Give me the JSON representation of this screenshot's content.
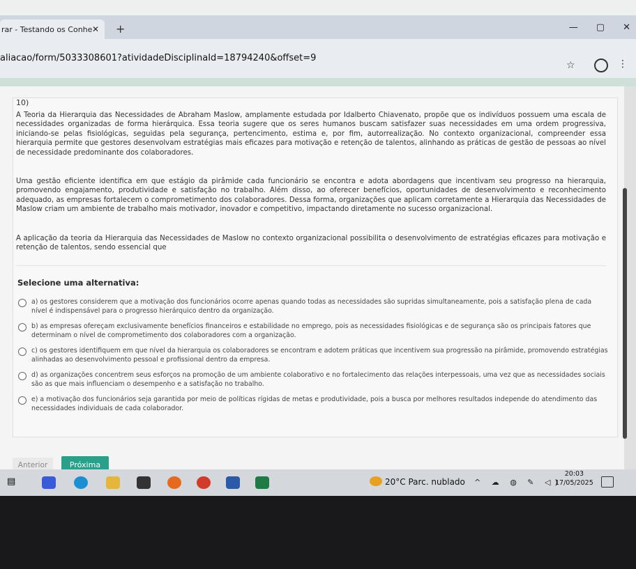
{
  "browser": {
    "tab_title": "rar - Testando os Conhe",
    "tab_close": "✕",
    "new_tab": "+",
    "url": "aliacao/form/5033308601?atividadeDisciplinaId=18794240&offset=9",
    "window_controls": {
      "minimize": "—",
      "maximize": "▢",
      "close": "✕"
    }
  },
  "question": {
    "number": "10)",
    "paragraphs": [
      "A Teoria da Hierarquia das Necessidades de Abraham Maslow, amplamente estudada por Idalberto Chiavenato, propõe que os indivíduos possuem uma escala de necessidades organizadas de forma hierárquica. Essa teoria sugere que os seres humanos buscam satisfazer suas necessidades em uma ordem progressiva, iniciando-se pelas fisiológicas, seguidas pela segurança, pertencimento, estima e, por fim, autorrealização. No contexto organizacional, compreender essa hierarquia permite que gestores desenvolvam estratégias mais eficazes para motivação e retenção de talentos, alinhando as práticas de gestão de pessoas ao nível de necessidade predominante dos colaboradores.",
      "Uma gestão eficiente identifica em que estágio da pirâmide cada funcionário se encontra e adota abordagens que incentivam seu progresso na hierarquia, promovendo engajamento, produtividade e satisfação no trabalho. Além disso, ao oferecer benefícios, oportunidades de desenvolvimento e reconhecimento adequado, as empresas fortalecem o comprometimento dos colaboradores. Dessa forma, organizações que aplicam corretamente a Hierarquia das Necessidades de Maslow criam um ambiente de trabalho mais motivador, inovador e competitivo, impactando diretamente no sucesso organizacional.",
      "A aplicação da teoria da Hierarquia das Necessidades de Maslow no contexto organizacional possibilita o desenvolvimento de estratégias eficazes para motivação e retenção de talentos, sendo essencial que"
    ],
    "select_label": "Selecione uma alternativa:",
    "alternatives": [
      "a) os gestores considerem que a motivação dos funcionários ocorre apenas quando todas as necessidades são supridas simultaneamente, pois a satisfação plena de cada nível é indispensável para o progresso hierárquico dentro da organização.",
      "b) as empresas ofereçam exclusivamente benefícios financeiros e estabilidade no emprego, pois as necessidades fisiológicas e de segurança são os principais fatores que determinam o nível de comprometimento dos colaboradores com a organização.",
      "c) os gestores identifiquem em que nível da hierarquia os colaboradores se encontram e adotem práticas que incentivem sua progressão na pirâmide, promovendo estratégias alinhadas ao desenvolvimento pessoal e profissional dentro da empresa.",
      "d) as organizações concentrem seus esforços na promoção de um ambiente colaborativo e no fortalecimento das relações interpessoais, uma vez que as necessidades sociais são as que mais influenciam o desempenho e a satisfação no trabalho.",
      "e) a motivação dos funcionários seja garantida por meio de políticas rígidas de metas e produtividade, pois a busca por melhores resultados independe do atendimento das necessidades individuais de cada colaborador."
    ]
  },
  "nav": {
    "previous": "Anterior",
    "next": "Próxima"
  },
  "taskbar": {
    "weather": "20°C  Parc. nublado",
    "time": "20:03",
    "date": "17/05/2025",
    "tray_glyphs": "^ ☁ ◍ ✎ ◁)"
  },
  "colors": {
    "accent": "#2aa08a",
    "taskbar": "#d4d8dc"
  }
}
